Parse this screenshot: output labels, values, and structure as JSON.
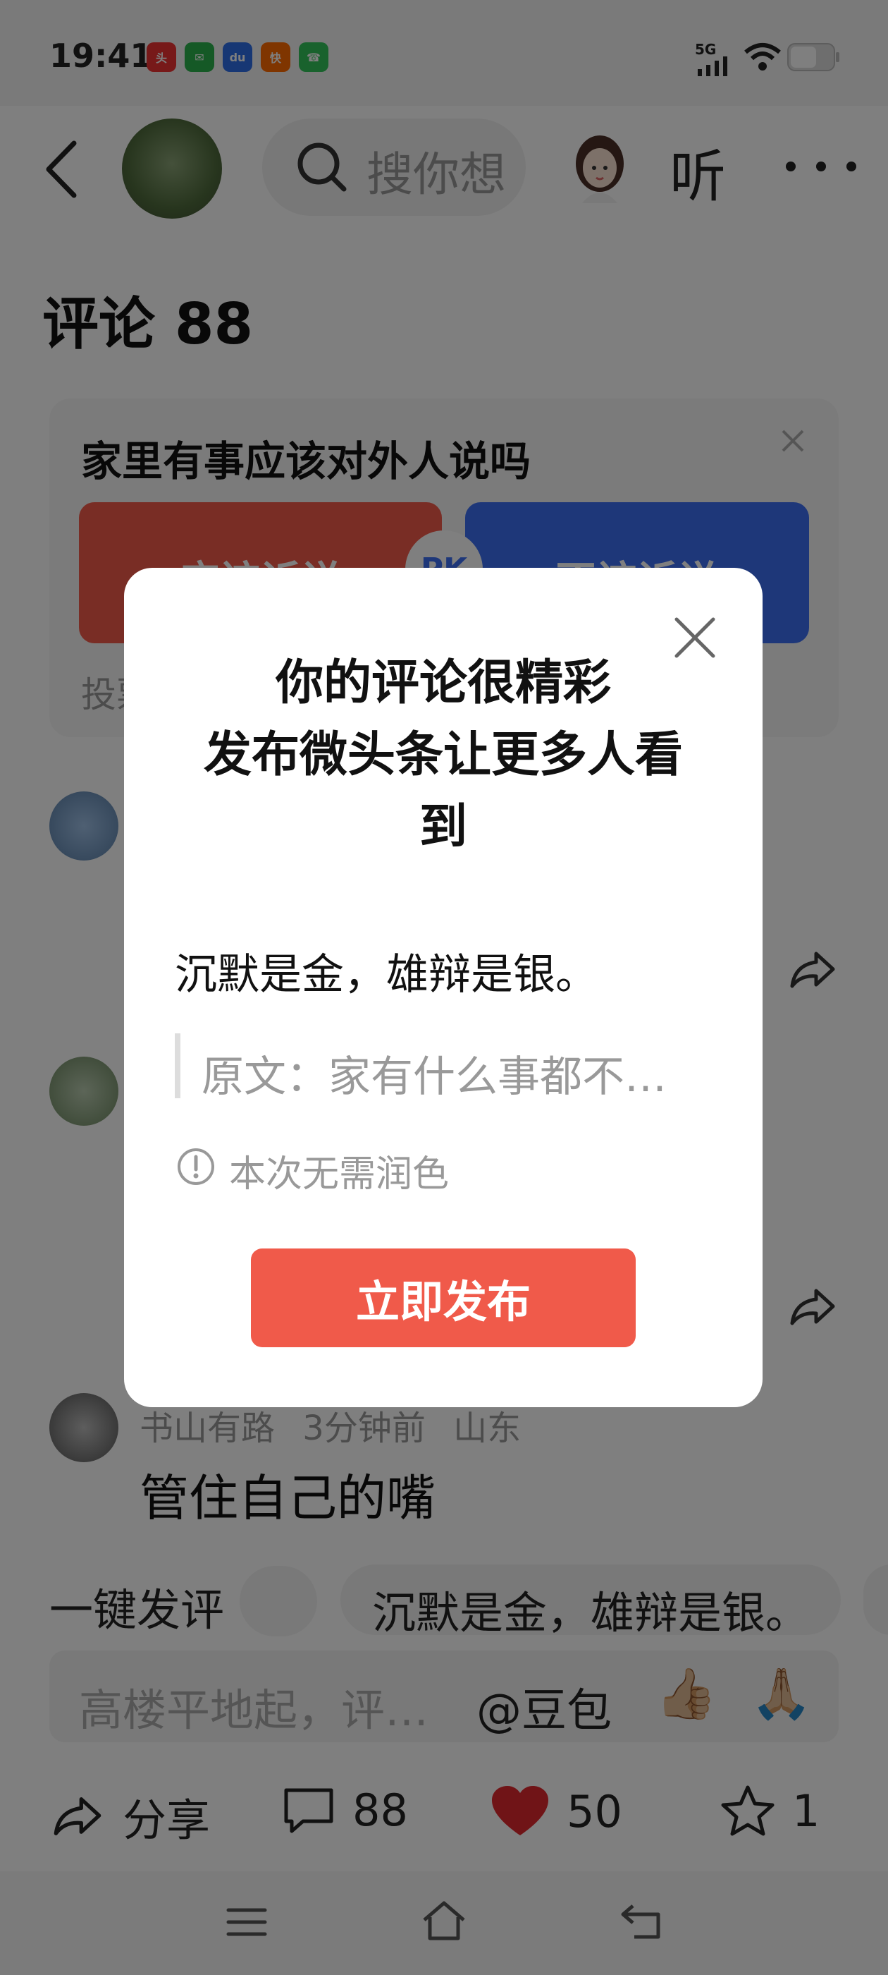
{
  "status_bar": {
    "time": "19:41",
    "app_icons": [
      "toutiao-icon",
      "wechat-icon",
      "baidu-icon",
      "kuaishou-icon",
      "phone-app-icon"
    ],
    "network": "5G",
    "icons": [
      "signal-icon",
      "wifi-icon",
      "battery-icon"
    ]
  },
  "header": {
    "search_placeholder": "搜你想",
    "listen_label": "听",
    "more_label": "···"
  },
  "comments_title": "评论 88",
  "vote_card": {
    "question": "家里有事应该对外人说吗",
    "left_option": "应该诉说",
    "right_option": "不该诉说",
    "pk_label": "PK",
    "hint": "投票"
  },
  "comments": [
    {
      "author": "书山有路",
      "time": "3分钟前",
      "location": "山东",
      "text": "管住自己的嘴"
    }
  ],
  "quick_comment": {
    "label": "一键发评",
    "suggestion": "沉默是金，雄辩是银。"
  },
  "input_bar": {
    "placeholder": "高楼平地起，评…",
    "mention": "@豆包",
    "emojis": [
      "👍🏼",
      "🙏🏼"
    ]
  },
  "actions": {
    "share_label": "分享",
    "comment_count": "88",
    "like_count": "50",
    "favorite_count": "1"
  },
  "dialog": {
    "title_line1": "你的评论很精彩",
    "title_line2": "发布微头条让更多人看到",
    "comment_text": "沉默是金，雄辩是银。",
    "original_text": "原文：家有什么事都不…",
    "note": "本次无需润色",
    "publish_button": "立即发布"
  },
  "colors": {
    "accent_red": "#f05a4a",
    "vote_blue": "#3d6ff2",
    "like_red": "#e0282e"
  }
}
